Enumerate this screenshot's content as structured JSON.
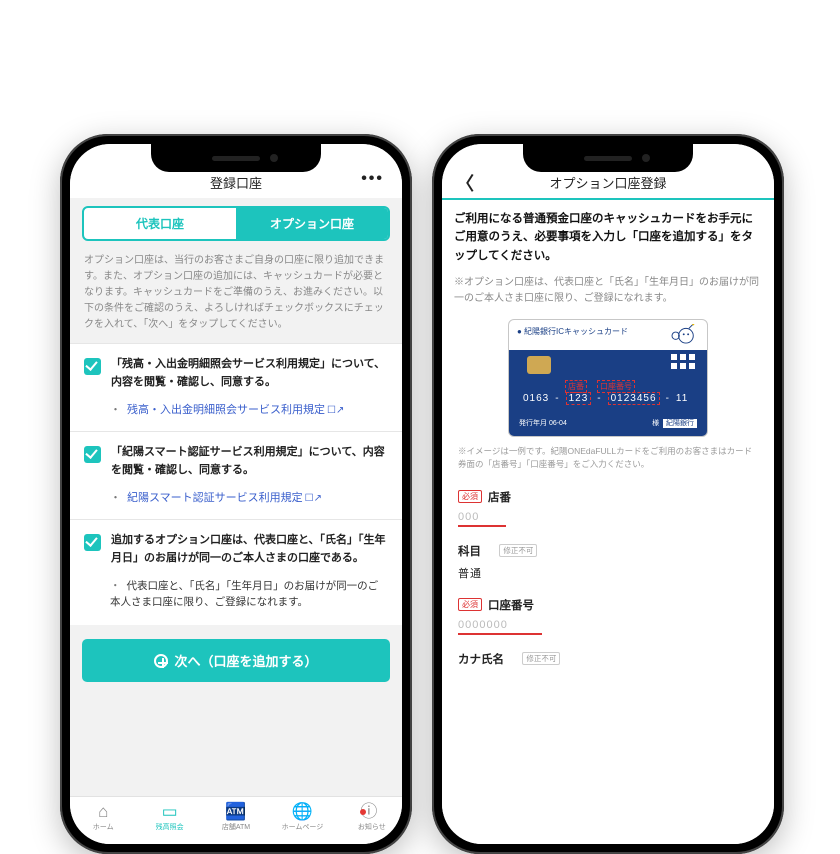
{
  "left": {
    "navTitle": "登録口座",
    "tabs": {
      "main": "代表口座",
      "option": "オプション口座"
    },
    "intro": "オプション口座は、当行のお客さまご自身の口座に限り追加できます。また、オプション口座の追加には、キャッシュカードが必要となります。キャッシュカードをご準備のうえ、お進みください。以下の条件をご確認のうえ、よろしければチェックボックスにチェックを入れて、「次へ」をタップしてください。",
    "checks": [
      {
        "text": "「残高・入出金明細照会サービス利用規定」について、内容を閲覧・確認し、同意する。",
        "link": "残高・入出金明細照会サービス利用規定"
      },
      {
        "text": "「紀陽スマート認証サービス利用規定」について、内容を閲覧・確認し、同意する。",
        "link": "紀陽スマート認証サービス利用規定"
      },
      {
        "text": "追加するオプション口座は、代表口座と、「氏名」「生年月日」のお届けが同一のご本人さまの口座である。",
        "note": "代表口座と、「氏名」「生年月日」のお届けが同一のご本人さま口座に限り、ご登録になれます。"
      }
    ],
    "cta": "次へ（口座を追加する）",
    "bottom": {
      "home": "ホーム",
      "balance": "残高照会",
      "atm": "店舗ATM",
      "hp": "ホームページ",
      "news": "お知らせ"
    }
  },
  "right": {
    "navTitle": "オプション口座登録",
    "intro": "ご利用になる普通預金口座のキャッシュカードをお手元にご用意のうえ、必要事項を入力し「口座を追加する」をタップしてください。",
    "note": "※オプション口座は、代表口座と「氏名」「生年月日」のお届けが同一のご本人さま口座に限り、ご登録になれます。",
    "card": {
      "brand": "● 紀陽銀行ICキャッシュカード",
      "labBranch": "店番",
      "labAcct": "口座番号",
      "numA": "0163",
      "numB": "123",
      "numC": "0123456",
      "numD": "11",
      "date": "発行年月 06-04",
      "holder": "様",
      "bank": "紀陽銀行"
    },
    "caption": "※イメージは一例です。紀陽ONEdaFULLカードをご利用のお客さまはカード券面の「店番号」「口座番号」をご入力ください。",
    "form": {
      "reqLabel": "必須",
      "roLabel": "修正不可",
      "branch": {
        "label": "店番",
        "ph": "000"
      },
      "type": {
        "label": "科目",
        "value": "普通"
      },
      "acct": {
        "label": "口座番号",
        "ph": "0000000"
      },
      "kana": {
        "label": "カナ氏名"
      }
    }
  }
}
